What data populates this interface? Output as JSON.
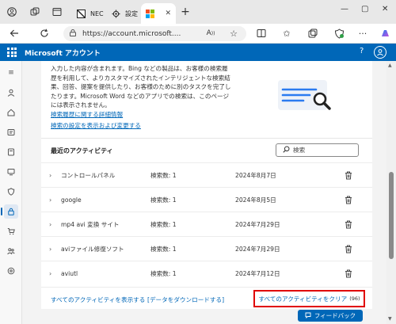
{
  "browser": {
    "tabs": [
      {
        "title": "NEC",
        "active": false
      },
      {
        "title": "設定",
        "active": false
      },
      {
        "title": "",
        "active": true
      }
    ],
    "url": "https://account.microsoft...."
  },
  "app": {
    "title": "Microsoft アカウント",
    "help": "?",
    "brand_color": "#0067b8"
  },
  "intro": {
    "lines": [
      "入力した内容が含まれます。Bing などの製品は、お客様の検索履",
      "歴を利用して、よりカスタマイズされたインテリジェントな検索結",
      "果、回答、提案を提供したり、お客様のために別のタスクを完了し",
      "たります。Microsoft Word などのアプリでの検索は、このページ",
      "には表示されません。"
    ],
    "link_details": "検索履歴に関する詳細情報",
    "link_settings": "検索の設定を表示および変更する"
  },
  "activity": {
    "section_title": "最近のアクティビティ",
    "search_placeholder": "検索",
    "rows": [
      {
        "name": "コントロールパネル",
        "count": "検索数: 1",
        "date": "2024年8月7日"
      },
      {
        "name": "google",
        "count": "検索数: 1",
        "date": "2024年8月5日"
      },
      {
        "name": "mp4 avi 変換 サイト",
        "count": "検索数: 1",
        "date": "2024年7月29日"
      },
      {
        "name": "aviファイル修復ソフト",
        "count": "検索数: 1",
        "date": "2024年7月29日"
      },
      {
        "name": "aviutl",
        "count": "検索数: 1",
        "date": "2024年7月12日"
      }
    ],
    "show_all": "すべてのアクティビティを表示する",
    "download": "[データをダウンロードする]",
    "clear_all": "すべてのアクティビティをクリア",
    "clear_count": "(96)"
  },
  "feedback": "フィードバック",
  "colors": {
    "highlight_border": "#e00000",
    "link": "#0067b8"
  }
}
